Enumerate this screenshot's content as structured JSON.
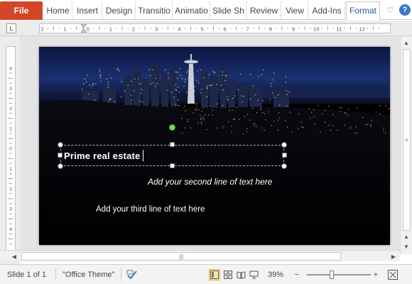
{
  "ribbon": {
    "file_label": "File",
    "tabs": [
      {
        "label": "Home"
      },
      {
        "label": "Insert"
      },
      {
        "label": "Design"
      },
      {
        "label": "Transitio"
      },
      {
        "label": "Animatio"
      },
      {
        "label": "Slide Sh"
      },
      {
        "label": "Review"
      },
      {
        "label": "View"
      },
      {
        "label": "Add-Ins"
      },
      {
        "label": "Format"
      }
    ],
    "active_tab": "Format",
    "collapse_icon": "heart-chevron-icon",
    "help_icon": "?"
  },
  "ruler": {
    "tab_selector": "L",
    "h_numbers": [
      "2",
      "1",
      "0",
      "1",
      "2",
      "3",
      "4",
      "5",
      "6",
      "7",
      "8",
      "9",
      "10",
      "11",
      "12"
    ],
    "v_numbers": [
      "4",
      "3",
      "2",
      "1",
      "0",
      "1",
      "2",
      "3",
      "4"
    ]
  },
  "slide": {
    "line1": "Prime real estate",
    "line2": "Add your  second  line of text here",
    "line3": "Add your third line of text  here",
    "photo_subject": "night city skyline"
  },
  "status": {
    "slide_info": "Slide 1 of 1",
    "theme": "\"Office Theme\"",
    "zoom": "39%",
    "zoom_minus": "−",
    "zoom_plus": "+"
  },
  "colors": {
    "file_tab": "#d24726",
    "slide_bg": "#000000",
    "rotation_handle": "#7ed957",
    "help_icon": "#3a79c8"
  }
}
